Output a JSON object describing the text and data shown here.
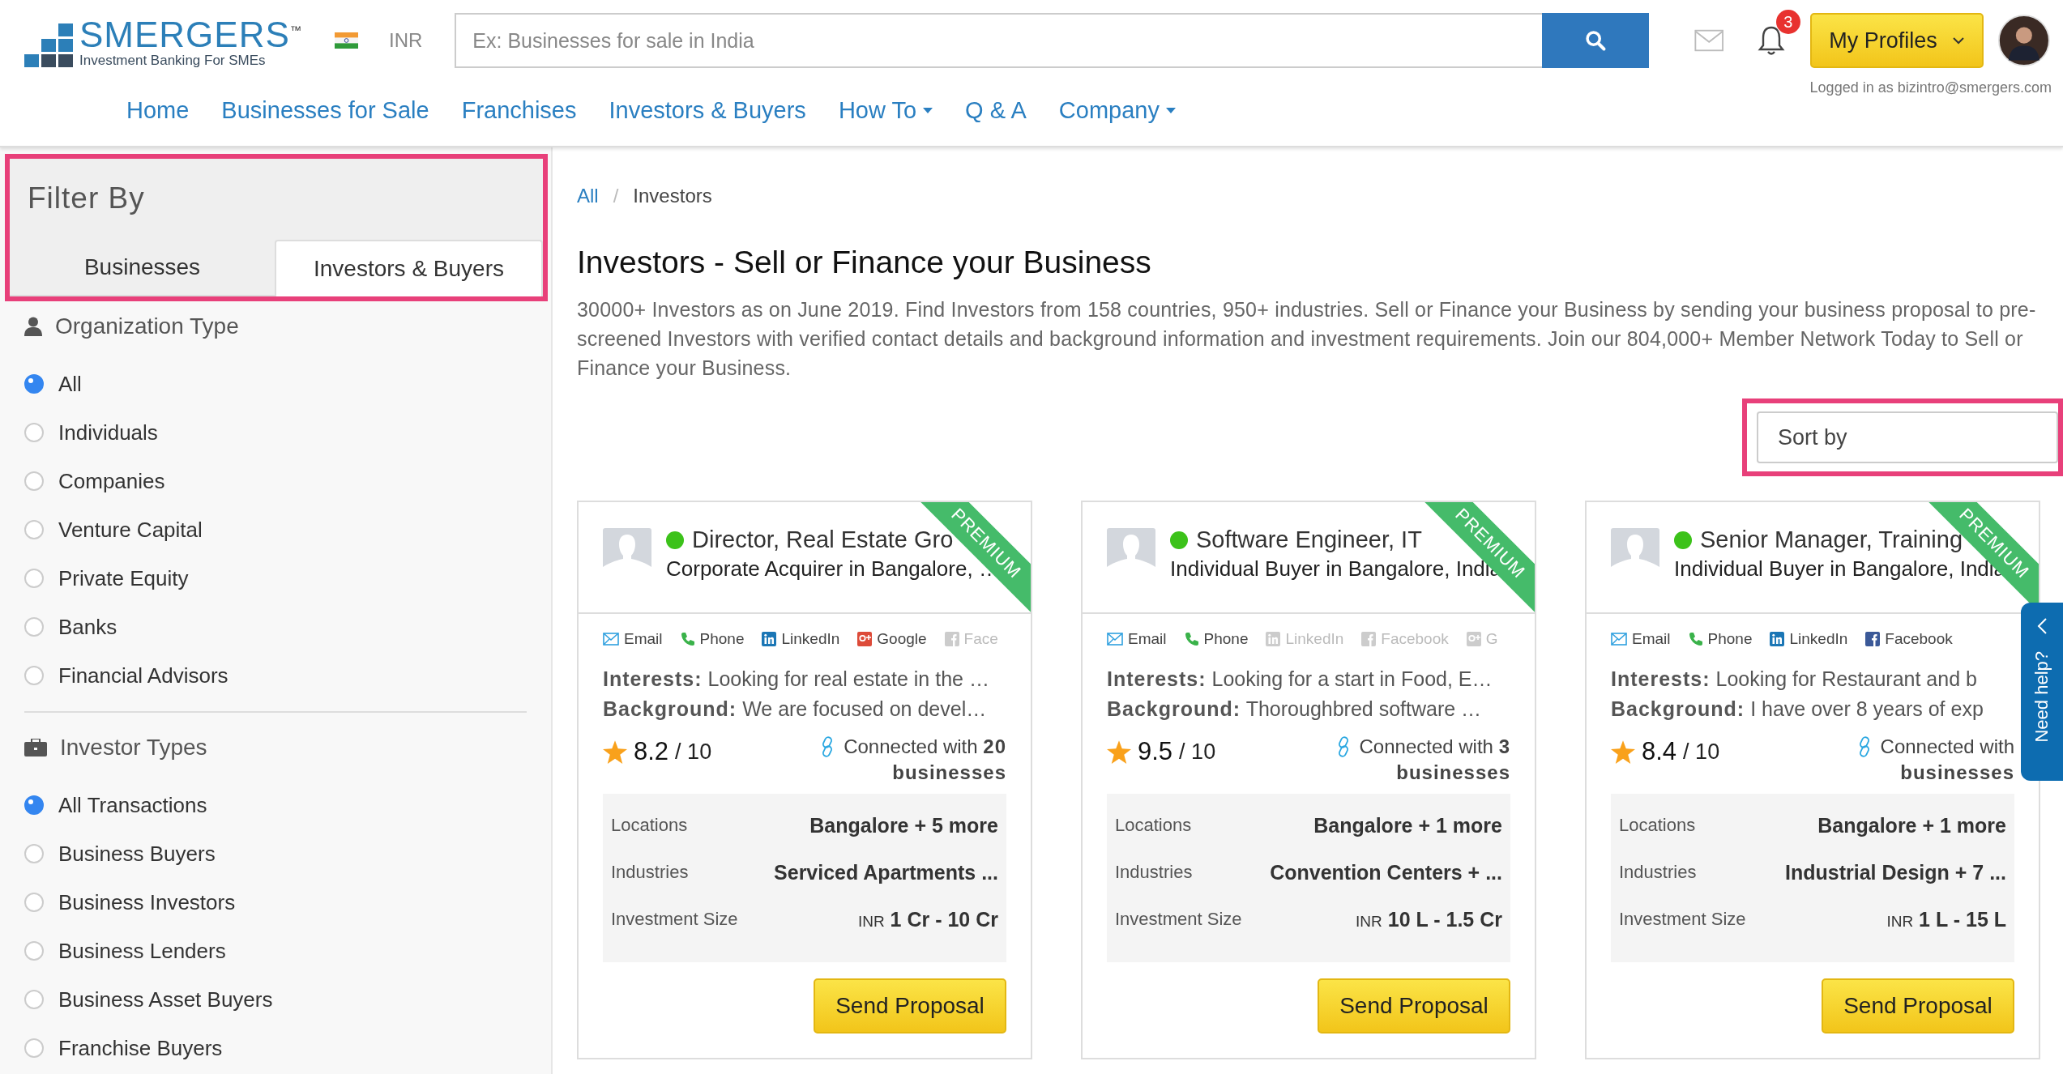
{
  "header": {
    "logo": {
      "name": "SMERGERS$^{™}$",
      "tagline": "Investment Banking For SMEs"
    },
    "currency": "INR",
    "search": {
      "placeholder": "Ex: Businesses for sale in India"
    },
    "notifications": {
      "count": "3"
    },
    "profile_button": "My Profiles",
    "logged_in": "Logged in as bizintro@smergers.com"
  },
  "nav": [
    {
      "label": "Home",
      "has_dropdown": false
    },
    {
      "label": "Businesses for Sale",
      "has_dropdown": false
    },
    {
      "label": "Franchises",
      "has_dropdown": false
    },
    {
      "label": "Investors & Buyers",
      "has_dropdown": false
    },
    {
      "label": "How To",
      "has_dropdown": true
    },
    {
      "label": "Q & A",
      "has_dropdown": false
    },
    {
      "label": "Company",
      "has_dropdown": true
    }
  ],
  "sidebar": {
    "title": "Filter By",
    "highlighted": true,
    "tabs": [
      {
        "label": "Businesses",
        "selected": false
      },
      {
        "label": "Investors & Buyers",
        "selected": true
      }
    ],
    "sections": [
      {
        "title": "Organization Type",
        "kind": "person",
        "options": [
          {
            "label": "All",
            "selected": true
          },
          {
            "label": "Individuals",
            "selected": false
          },
          {
            "label": "Companies",
            "selected": false
          },
          {
            "label": "Venture Capital",
            "selected": false
          },
          {
            "label": "Private Equity",
            "selected": false
          },
          {
            "label": "Banks",
            "selected": false
          },
          {
            "label": "Financial Advisors",
            "selected": false
          }
        ]
      },
      {
        "title": "Investor Types",
        "kind": "briefcase",
        "options": [
          {
            "label": "All Transactions",
            "selected": true
          },
          {
            "label": "Business Buyers",
            "selected": false
          },
          {
            "label": "Business Investors",
            "selected": false
          },
          {
            "label": "Business Lenders",
            "selected": false
          },
          {
            "label": "Business Asset Buyers",
            "selected": false
          },
          {
            "label": "Franchise Buyers",
            "selected": false
          }
        ]
      }
    ]
  },
  "breadcrumb": [
    {
      "label": "All",
      "link": true
    },
    {
      "separator": "/",
      "label": "Investors",
      "link": false
    }
  ],
  "page_title": "Investors - Sell or Finance your Business",
  "intro": "30000+ Investors as on June 2019. Find Investors from 158 countries, 950+ industries. Sell or Finance your Business by sending your business proposal to pre-screened Investors with verified contact details and background information and investment requirements. Join our 804,000+ Member Network Today to Sell or Finance your Business.",
  "sort": {
    "label": "Sort by",
    "highlighted": true
  },
  "cards": [
    {
      "title": "Director, Real Estate Gro",
      "subtitle": "Corporate Acquirer in Bangalore, …",
      "badge": "PREMIUM",
      "online": true,
      "contacts": [
        {
          "kind": "email",
          "label": "Email",
          "available": true
        },
        {
          "kind": "phone",
          "label": "Phone",
          "available": true
        },
        {
          "kind": "linkedin",
          "label": "LinkedIn",
          "available": true
        },
        {
          "kind": "google",
          "label": "Google",
          "available": true
        },
        {
          "kind": "facebook",
          "label": "Face",
          "available": false
        }
      ],
      "interests": "**Interests:** Looking for real estate in the …",
      "background": "**Background:** We are focused on devel…",
      "rating": "8.2",
      "rating_max": "/ 10",
      "connected": "Connected with **20**",
      "connected_unit": "businesses",
      "details": [
        {
          "label": "Locations",
          "value": "Bangalore + 5 more"
        },
        {
          "label": "Industries",
          "value": "Serviced Apartments ..."
        },
        {
          "label": "Investment Size",
          "currency": "INR",
          "value": "1 Cr - 10 Cr"
        }
      ],
      "action": "Send Proposal"
    },
    {
      "title": "Software Engineer, IT",
      "subtitle": "Individual Buyer in Bangalore, India",
      "badge": "PREMIUM",
      "online": true,
      "contacts": [
        {
          "kind": "email",
          "label": "Email",
          "available": true
        },
        {
          "kind": "phone",
          "label": "Phone",
          "available": true
        },
        {
          "kind": "linkedin",
          "label": "LinkedIn",
          "available": false
        },
        {
          "kind": "facebook",
          "label": "Facebook",
          "available": false
        },
        {
          "kind": "google",
          "label": "G",
          "available": false
        }
      ],
      "interests": "**Interests:** Looking for a start in Food, E…",
      "background": "**Background:** Thoroughbred software …",
      "rating": "9.5",
      "rating_max": "/ 10",
      "connected": "Connected with **3**",
      "connected_unit": "businesses",
      "details": [
        {
          "label": "Locations",
          "value": "Bangalore + 1 more"
        },
        {
          "label": "Industries",
          "value": "Convention Centers + ..."
        },
        {
          "label": "Investment Size",
          "currency": "INR",
          "value": "10 L - 1.5 Cr"
        }
      ],
      "action": "Send Proposal"
    },
    {
      "title": "Senior Manager, Training",
      "subtitle": "Individual Buyer in Bangalore, India",
      "badge": "PREMIUM",
      "online": true,
      "contacts": [
        {
          "kind": "email",
          "label": "Email",
          "available": true
        },
        {
          "kind": "phone",
          "label": "Phone",
          "available": true
        },
        {
          "kind": "linkedin",
          "label": "LinkedIn",
          "available": true
        },
        {
          "kind": "facebook",
          "label": "Facebook",
          "available": true
        }
      ],
      "interests": "**Interests:** Looking for Restaurant and b",
      "background": "**Background:** I have over 8 years of exp",
      "rating": "8.4",
      "rating_max": "/ 10",
      "connected": "Connected with",
      "connected_unit": "businesses",
      "details": [
        {
          "label": "Locations",
          "value": "Bangalore + 1 more"
        },
        {
          "label": "Industries",
          "value": "Industrial Design + 7 ..."
        },
        {
          "label": "Investment Size",
          "currency": "INR",
          "value": "1 L - 15 L"
        }
      ],
      "action": "Send Proposal"
    }
  ],
  "help_tab": {
    "label": "Need help?"
  }
}
